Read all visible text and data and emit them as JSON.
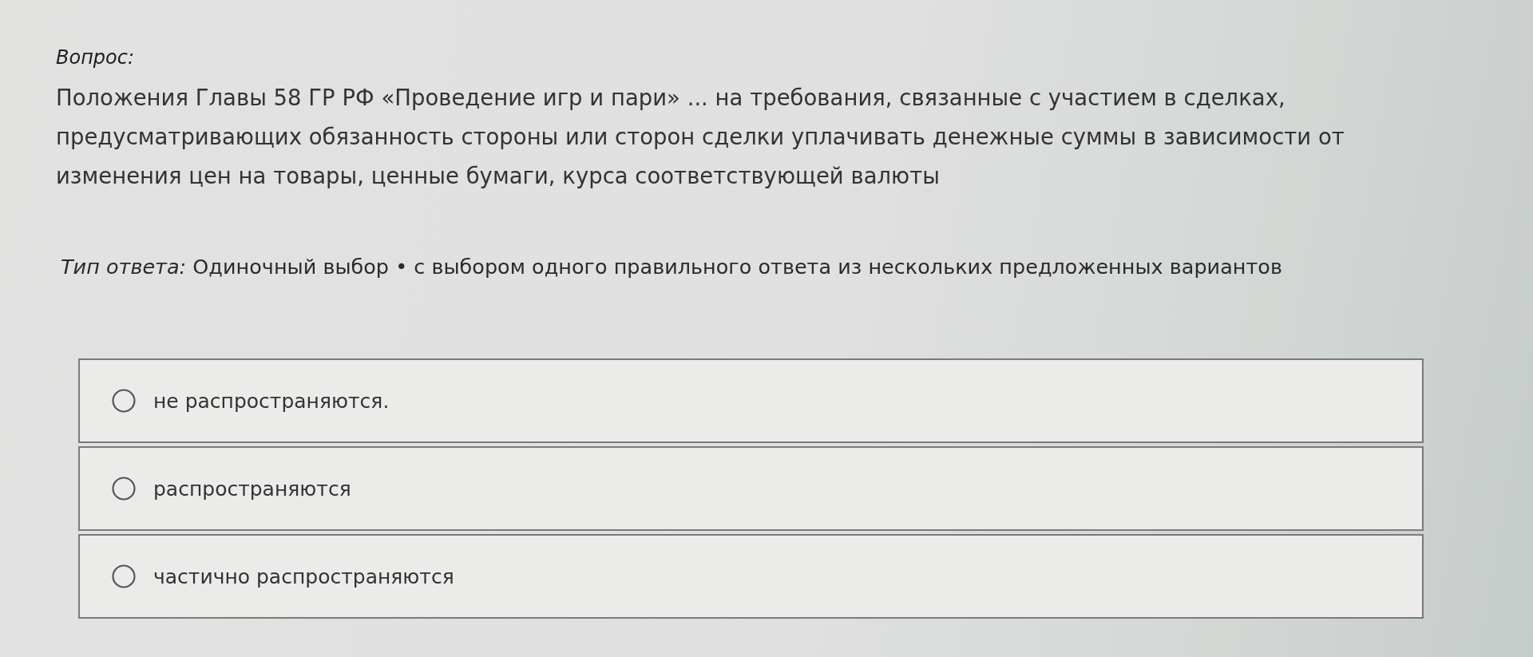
{
  "question": {
    "label": "Вопрос:",
    "text": "Положения Главы 58 ГР РФ «Проведение игр и пари» ... на требования, связанные с участием в сделках, предусматривающих обязанность стороны или сторон сделки уплачивать денежные суммы в зависимости от изменения цен на товары, ценные бумаги, курса соответствующей валюты"
  },
  "answer_type": {
    "label": "Тип ответа:",
    "value": "Одиночный выбор • с выбором одного правильного ответа из нескольких предложенных вариантов"
  },
  "options": [
    {
      "label": "не распространяются.",
      "selected": false
    },
    {
      "label": "распространяются",
      "selected": false
    },
    {
      "label": "частично распространяются",
      "selected": false
    }
  ]
}
